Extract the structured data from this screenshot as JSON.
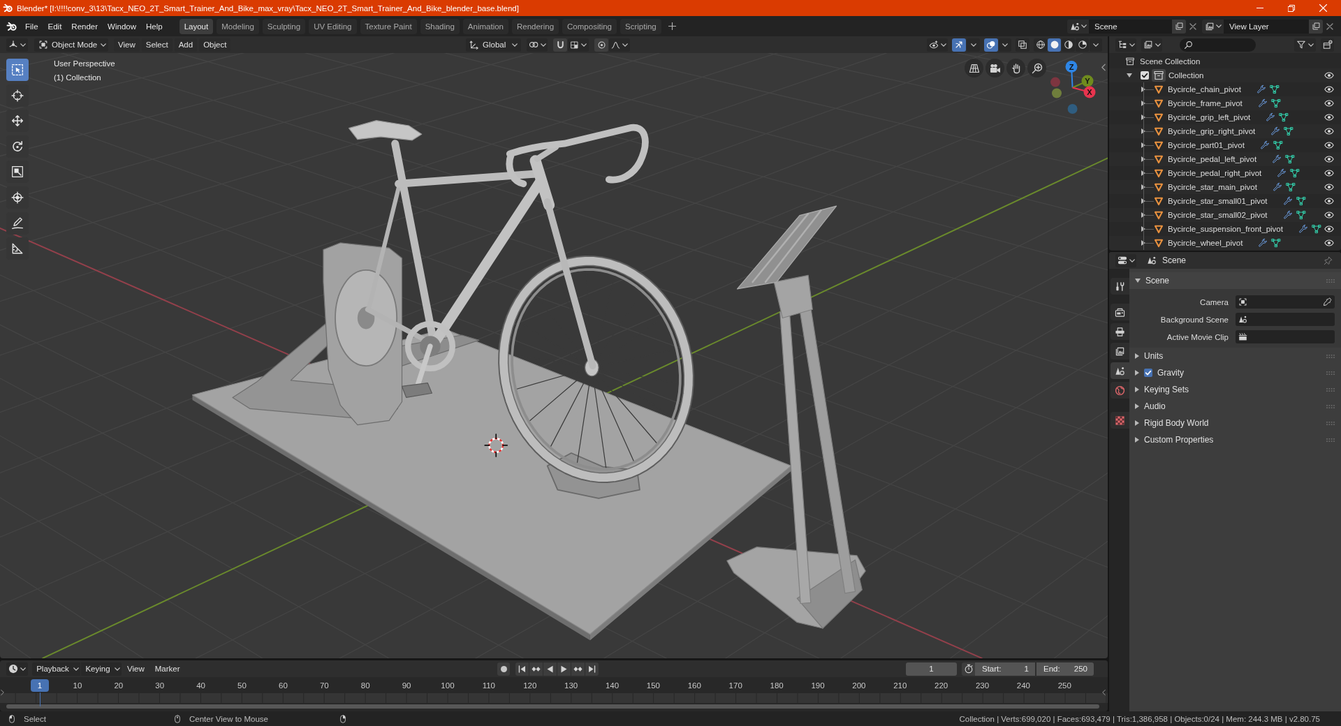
{
  "window": {
    "title": "Blender* [I:\\!!!!conv_3\\13\\Tacx_NEO_2T_Smart_Trainer_And_Bike_max_vray\\Tacx_NEO_2T_Smart_Trainer_And_Bike_blender_base.blend]"
  },
  "menu": [
    "File",
    "Edit",
    "Render",
    "Window",
    "Help"
  ],
  "workspace_tabs": [
    {
      "label": "Layout",
      "selected": true
    },
    {
      "label": "Modeling",
      "selected": false
    },
    {
      "label": "Sculpting",
      "selected": false
    },
    {
      "label": "UV Editing",
      "selected": false
    },
    {
      "label": "Texture Paint",
      "selected": false
    },
    {
      "label": "Shading",
      "selected": false
    },
    {
      "label": "Animation",
      "selected": false
    },
    {
      "label": "Rendering",
      "selected": false
    },
    {
      "label": "Compositing",
      "selected": false
    },
    {
      "label": "Scripting",
      "selected": false
    }
  ],
  "scene": {
    "value": "Scene"
  },
  "view_layer": {
    "value": "View Layer"
  },
  "viewport": {
    "mode": "Object Mode",
    "menus": [
      "View",
      "Select",
      "Add",
      "Object"
    ],
    "orientation": "Global",
    "gizmos_on": true,
    "overlays_on": true,
    "xray_on": false,
    "shading": [
      {
        "kind": "wireframe",
        "selected": false
      },
      {
        "kind": "solid",
        "selected": true
      },
      {
        "kind": "material",
        "selected": false
      },
      {
        "kind": "rendered",
        "selected": false
      }
    ],
    "tools": [
      {
        "kind": "select-box",
        "selected": true
      },
      {
        "kind": "cursor",
        "selected": false
      },
      {
        "kind": "move",
        "selected": false
      },
      {
        "kind": "rotate",
        "selected": false
      },
      {
        "kind": "scale",
        "selected": false
      },
      {
        "kind": "transform",
        "selected": false
      },
      {
        "kind": "annotate",
        "selected": false
      },
      {
        "kind": "measure",
        "selected": false
      }
    ],
    "info": [
      "User Perspective",
      "(1) Collection"
    ],
    "axes": [
      {
        "label": "Z",
        "color": "#2e86e6"
      },
      {
        "label": "Y",
        "color": "#6f8b1e"
      },
      {
        "label": "X",
        "color": "#e8344e"
      }
    ]
  },
  "outliner": {
    "root": "Scene Collection",
    "items": [
      {
        "label": "Collection",
        "kind": "collection",
        "expanded": true,
        "checked": true,
        "visible": true,
        "children": [
          {
            "label": "Bycircle_chain_pivot",
            "kind": "mesh",
            "expanded": false,
            "visible": true
          },
          {
            "label": "Bycircle_frame_pivot",
            "kind": "mesh",
            "expanded": false,
            "visible": true
          },
          {
            "label": "Bycircle_grip_left_pivot",
            "kind": "mesh",
            "expanded": false,
            "visible": true
          },
          {
            "label": "Bycircle_grip_right_pivot",
            "kind": "mesh",
            "expanded": false,
            "visible": true
          },
          {
            "label": "Bycircle_part01_pivot",
            "kind": "mesh",
            "expanded": false,
            "visible": true
          },
          {
            "label": "Bycircle_pedal_left_pivot",
            "kind": "mesh",
            "expanded": false,
            "visible": true
          },
          {
            "label": "Bycircle_pedal_right_pivot",
            "kind": "mesh",
            "expanded": false,
            "visible": true
          },
          {
            "label": "Bycircle_star_main_pivot",
            "kind": "mesh",
            "expanded": false,
            "visible": true
          },
          {
            "label": "Bycircle_star_small01_pivot",
            "kind": "mesh",
            "expanded": false,
            "visible": true
          },
          {
            "label": "Bycircle_star_small02_pivot",
            "kind": "mesh",
            "expanded": false,
            "visible": true
          },
          {
            "label": "Bycircle_suspension_front_pivot",
            "kind": "mesh",
            "expanded": false,
            "visible": true
          },
          {
            "label": "Bycircle_wheel_pivot",
            "kind": "mesh",
            "expanded": false,
            "visible": true
          }
        ]
      }
    ]
  },
  "properties": {
    "context": "Scene",
    "tabs": [
      {
        "kind": "tool",
        "selected": false
      },
      {
        "kind": "render",
        "selected": false
      },
      {
        "kind": "output",
        "selected": false
      },
      {
        "kind": "view-layer",
        "selected": false
      },
      {
        "kind": "scene",
        "selected": true
      },
      {
        "kind": "world",
        "selected": false
      },
      {
        "kind": "texture",
        "selected": false
      }
    ],
    "panels": [
      {
        "label": "Scene",
        "kind": "plain",
        "expanded": true,
        "fields": [
          {
            "label": "Camera",
            "kind": "object"
          },
          {
            "label": "Background Scene",
            "kind": "scene"
          },
          {
            "label": "Active Movie Clip",
            "kind": "clip"
          }
        ]
      },
      {
        "label": "Units",
        "kind": "plain",
        "expanded": false
      },
      {
        "label": "Gravity",
        "kind": "toggle",
        "expanded": false,
        "checked": true
      },
      {
        "label": "Keying Sets",
        "kind": "plain",
        "expanded": false
      },
      {
        "label": "Audio",
        "kind": "plain",
        "expanded": false
      },
      {
        "label": "Rigid Body World",
        "kind": "plain",
        "expanded": false
      },
      {
        "label": "Custom Properties",
        "kind": "plain",
        "expanded": false
      }
    ]
  },
  "timeline": {
    "menus": [
      {
        "label": "Playback",
        "kind": "dropdown"
      },
      {
        "label": "Keying",
        "kind": "dropdown"
      },
      {
        "label": "View",
        "kind": "menu"
      },
      {
        "label": "Marker",
        "kind": "menu"
      }
    ],
    "auto_keying_on": false,
    "current_frame": "1",
    "start": {
      "label": "Start:",
      "value": "1"
    },
    "end": {
      "label": "End:",
      "value": "250"
    },
    "playhead": "1",
    "ruler": [
      "10",
      "20",
      "30",
      "40",
      "50",
      "60",
      "70",
      "80",
      "90",
      "100",
      "110",
      "120",
      "130",
      "140",
      "150",
      "160",
      "170",
      "180",
      "190",
      "200",
      "210",
      "220",
      "230",
      "240",
      "250"
    ]
  },
  "status_bar": {
    "hints": [
      {
        "kind": "left-click",
        "label": "Select"
      },
      {
        "kind": "middle-click",
        "label": "Center View to Mouse"
      },
      {
        "kind": "right-click"
      }
    ],
    "stats": "Collection | Verts:699,020 | Faces:693,479 | Tris:1,386,958 | Objects:0/24 | Mem: 244.3 MB | v2.80.75"
  }
}
